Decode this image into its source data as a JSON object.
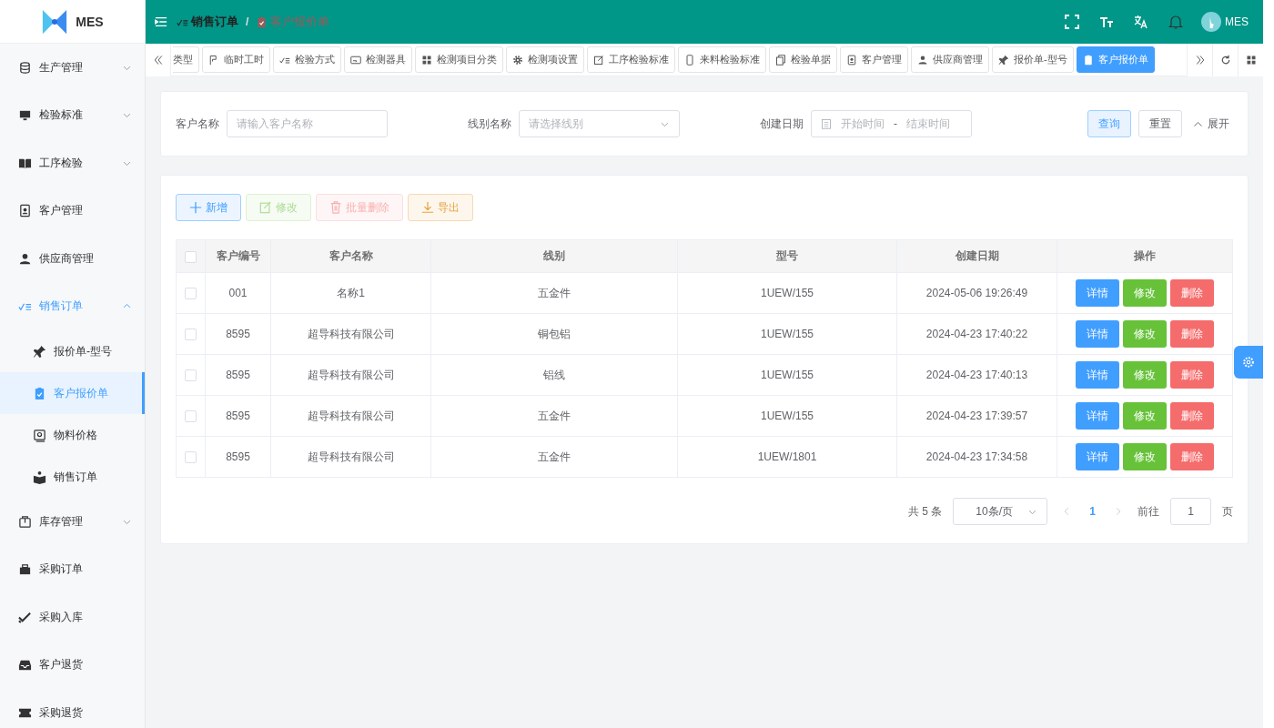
{
  "logo": {
    "text": "MES"
  },
  "sidebar": {
    "items": [
      {
        "label": "生产管理",
        "kind": "submenu",
        "expanded": false
      },
      {
        "label": "检验标准",
        "kind": "submenu",
        "expanded": false
      },
      {
        "label": "工序检验",
        "kind": "submenu",
        "expanded": false
      },
      {
        "label": "客户管理",
        "kind": "item"
      },
      {
        "label": "供应商管理",
        "kind": "item"
      },
      {
        "label": "销售订单",
        "kind": "submenu",
        "expanded": true,
        "children": [
          {
            "label": "报价单-型号",
            "selected": false
          },
          {
            "label": "客户报价单",
            "selected": true
          },
          {
            "label": "物料价格",
            "selected": false
          },
          {
            "label": "销售订单",
            "selected": false
          }
        ]
      },
      {
        "label": "库存管理",
        "kind": "submenu",
        "expanded": false
      },
      {
        "label": "采购订单",
        "kind": "item"
      },
      {
        "label": "采购入库",
        "kind": "item"
      },
      {
        "label": "客户退货",
        "kind": "item"
      },
      {
        "label": "采购退货",
        "kind": "item"
      }
    ]
  },
  "header": {
    "breadcrumb": [
      {
        "label": "销售订单",
        "current": false
      },
      {
        "label": "客户报价单",
        "current": true
      }
    ],
    "separator": "/",
    "user": "MES"
  },
  "tabs": [
    {
      "label": "类型",
      "selected": false
    },
    {
      "label": "临时工时",
      "selected": false
    },
    {
      "label": "检验方式",
      "selected": false
    },
    {
      "label": "检测器具",
      "selected": false
    },
    {
      "label": "检测项目分类",
      "selected": false
    },
    {
      "label": "检测项设置",
      "selected": false
    },
    {
      "label": "工序检验标准",
      "selected": false
    },
    {
      "label": "来料检验标准",
      "selected": false
    },
    {
      "label": "检验单据",
      "selected": false
    },
    {
      "label": "客户管理",
      "selected": false
    },
    {
      "label": "供应商管理",
      "selected": false
    },
    {
      "label": "报价单-型号",
      "selected": false
    },
    {
      "label": "客户报价单",
      "selected": true
    }
  ],
  "search": {
    "fields": [
      {
        "label": "客户名称",
        "kind": "input",
        "placeholder": "请输入客户名称"
      },
      {
        "label": "线别名称",
        "kind": "select",
        "placeholder": "请选择线别"
      },
      {
        "label": "创建日期",
        "kind": "daterange",
        "placeholder": "开始时间",
        "placeholder_end": "结束时间",
        "separator": "-"
      }
    ],
    "buttons": [
      {
        "label": "查询",
        "kind": "primary"
      },
      {
        "label": "重置",
        "kind": "default"
      },
      {
        "label": "展开",
        "kind": "link"
      }
    ]
  },
  "toolbar": [
    {
      "label": "新增",
      "kind": "primary",
      "disabled": false
    },
    {
      "label": "修改",
      "kind": "success",
      "disabled": true
    },
    {
      "label": "批量删除",
      "kind": "danger",
      "disabled": true
    },
    {
      "label": "导出",
      "kind": "warning",
      "disabled": false
    }
  ],
  "table": {
    "all_checked": false,
    "columns": [
      "客户编号",
      "客户名称",
      "线别",
      "型号",
      "创建日期",
      "操作"
    ],
    "rows": [
      {
        "checked": false,
        "cells": [
          "001",
          "名称1",
          "五金件",
          "1UEW/155",
          "2024-05-06 19:26:49"
        ],
        "actions": [
          "详情",
          "修改",
          "删除"
        ]
      },
      {
        "checked": false,
        "cells": [
          "8595",
          "超导科技有限公司",
          "铜包铝",
          "1UEW/155",
          "2024-04-23 17:40:22"
        ],
        "actions": [
          "详情",
          "修改",
          "删除"
        ]
      },
      {
        "checked": false,
        "cells": [
          "8595",
          "超导科技有限公司",
          "铝线",
          "1UEW/155",
          "2024-04-23 17:40:13"
        ],
        "actions": [
          "详情",
          "修改",
          "删除"
        ]
      },
      {
        "checked": false,
        "cells": [
          "8595",
          "超导科技有限公司",
          "五金件",
          "1UEW/155",
          "2024-04-23 17:39:57"
        ],
        "actions": [
          "详情",
          "修改",
          "删除"
        ]
      },
      {
        "checked": false,
        "cells": [
          "8595",
          "超导科技有限公司",
          "五金件",
          "1UEW/1801",
          "2024-04-23 17:34:58"
        ],
        "actions": [
          "详情",
          "修改",
          "删除"
        ]
      }
    ]
  },
  "pagination": {
    "total": "共 5 条",
    "page_size": "10条/页",
    "pages": [
      {
        "label": "1",
        "selected": true
      }
    ],
    "goto": "前往",
    "goto_value": "1",
    "page_unit": "页"
  }
}
